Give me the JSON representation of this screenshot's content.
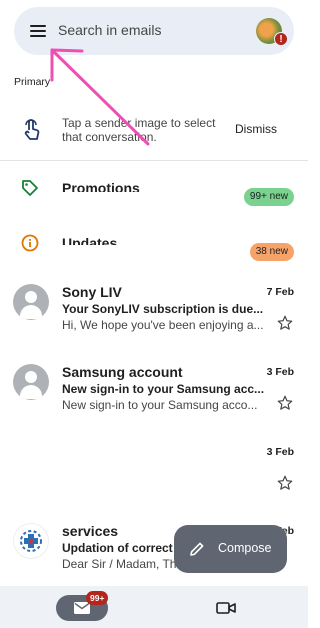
{
  "search": {
    "placeholder": "Search in emails"
  },
  "section_label": "Primary",
  "tip": {
    "text": "Tap a sender image to select that conversation.",
    "dismiss_label": "Dismiss"
  },
  "categories": [
    {
      "title": "Promotions",
      "badge": "99+ new",
      "badge_color": "#79d28f",
      "icon": "tag-icon",
      "icon_color": "#188038"
    },
    {
      "title": "Updates",
      "badge": "38 new",
      "badge_color": "#f6a36a",
      "icon": "info-icon",
      "icon_color": "#e37400"
    }
  ],
  "emails": [
    {
      "sender": "Sony LIV",
      "date": "7 Feb",
      "subject": "Your SonyLIV subscription is due...",
      "snippet": "Hi, We hope you've been enjoying a..."
    },
    {
      "sender": "Samsung account",
      "date": "3 Feb",
      "subject": "New sign-in to your Samsung acc...",
      "snippet": "New sign-in to your Samsung acco..."
    },
    {
      "sender": "",
      "date": "3 Feb",
      "subject": "",
      "snippet": ""
    },
    {
      "sender": "services",
      "date": "3 Feb",
      "subject": "Updation of correct",
      "snippet": "Dear Sir / Madam, Thi"
    }
  ],
  "compose_label": "Compose",
  "nav": {
    "mail_badge": "99+"
  },
  "colors": {
    "accent_arrow": "#ee4fb3",
    "search_bg": "#e9eef6",
    "compose_bg": "#5f6672"
  }
}
